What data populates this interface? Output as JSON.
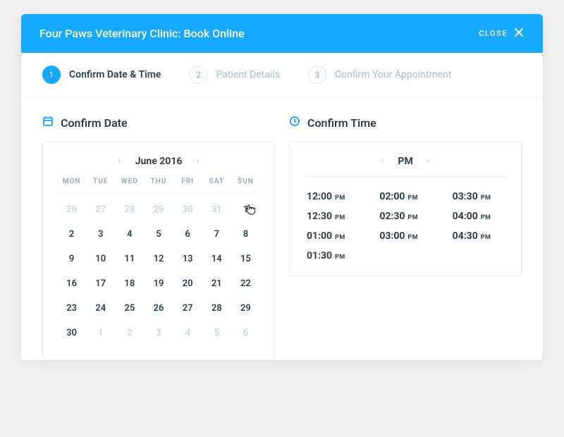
{
  "header": {
    "title": "Four Paws Veterinary Clinic: Book Online",
    "close_label": "CLOSE"
  },
  "steps": {
    "s1": {
      "num": "1",
      "label": "Confirm Date & Time"
    },
    "s2": {
      "num": "2",
      "label": "Patient Details"
    },
    "s3": {
      "num": "3",
      "label": "Confirm Your Appointment"
    }
  },
  "date": {
    "section_title": "Confirm Date",
    "month_label": "June 2016",
    "dow": {
      "d0": "MON",
      "d1": "TUE",
      "d2": "WED",
      "d3": "THU",
      "d4": "FRI",
      "d5": "SAT",
      "d6": "SUN"
    },
    "cells": {
      "r0": {
        "c0": "26",
        "c1": "27",
        "c2": "28",
        "c3": "29",
        "c4": "30",
        "c5": "31",
        "c6": "1"
      },
      "r1": {
        "c0": "2",
        "c1": "3",
        "c2": "4",
        "c3": "5",
        "c4": "6",
        "c5": "7",
        "c6": "8"
      },
      "r2": {
        "c0": "9",
        "c1": "10",
        "c2": "11",
        "c3": "12",
        "c4": "13",
        "c5": "14",
        "c6": "15"
      },
      "r3": {
        "c0": "16",
        "c1": "17",
        "c2": "18",
        "c3": "19",
        "c4": "20",
        "c5": "21",
        "c6": "22"
      },
      "r4": {
        "c0": "23",
        "c1": "24",
        "c2": "25",
        "c3": "26",
        "c4": "27",
        "c5": "28",
        "c6": "29"
      },
      "r5": {
        "c0": "30",
        "c1": "1",
        "c2": "2",
        "c3": "3",
        "c4": "4",
        "c5": "5",
        "c6": "6"
      }
    }
  },
  "time": {
    "section_title": "Confirm Time",
    "period": "PM",
    "ampm": "PM",
    "slots": {
      "s0": "12:00",
      "s1": "02:00",
      "s2": "03:30",
      "s3": "12:30",
      "s4": "02:30",
      "s5": "04:00",
      "s6": "01:00",
      "s7": "03:00",
      "s8": "04:30",
      "s9": "01:30"
    }
  }
}
